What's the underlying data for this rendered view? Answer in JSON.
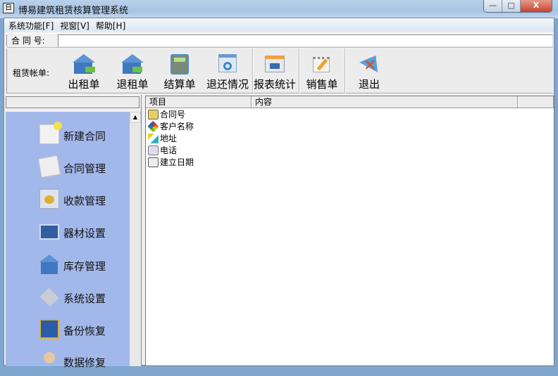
{
  "window": {
    "title": "博易建筑租赁核算管理系统",
    "app_icon": "日",
    "min": "—",
    "max": "□",
    "close": "X"
  },
  "menu": [
    "系统功能[F]",
    "视窗[V]",
    "帮助[H]"
  ],
  "contract": {
    "label": "合 同 号:",
    "value": ""
  },
  "toolbar": {
    "label": "租赁帐单:",
    "buttons": [
      {
        "label": "出租单",
        "icon": "house-arrow-out-icon"
      },
      {
        "label": "退租单",
        "icon": "house-arrow-in-icon"
      },
      {
        "label": "结算单",
        "icon": "calculator-icon"
      },
      {
        "label": "退还情况",
        "icon": "refresh-window-icon"
      },
      {
        "label": "报表统计",
        "icon": "report-icon"
      },
      {
        "label": "销售单",
        "icon": "notepad-pencil-icon"
      },
      {
        "label": "退出",
        "icon": "exit-icon"
      }
    ]
  },
  "sidebar": {
    "items": [
      "新建合同",
      "合同管理",
      "收款管理",
      "器材设置",
      "库存管理",
      "系统设置",
      "备份恢复",
      "数据修复"
    ]
  },
  "table": {
    "columns": [
      "项目",
      "内容"
    ],
    "rows": [
      "合同号",
      "客户名称",
      "地址",
      "电话",
      "建立日期"
    ]
  }
}
